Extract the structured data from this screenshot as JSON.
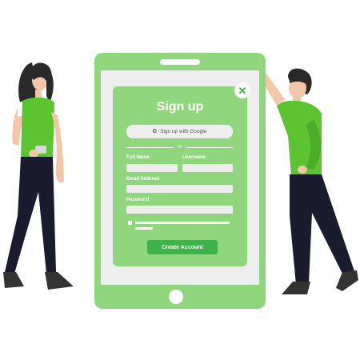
{
  "form": {
    "title": "Sign up",
    "close_icon": "close-icon",
    "google_button_label": "Sign up with Google",
    "google_icon_glyph": "G",
    "divider_text": "Or",
    "full_name_label": "Full Name",
    "username_label": "Username",
    "email_label": "Email Address",
    "password_label": "Password",
    "full_name_value": "",
    "username_value": "",
    "email_value": "",
    "password_value": "",
    "submit_label": "Create Account"
  },
  "colors": {
    "accent": "#3db34a",
    "light_green": "#8fd67d",
    "shirt_green": "#5cc431",
    "pants_navy": "#1a1b2e",
    "screen_gray": "#eeeeee"
  }
}
